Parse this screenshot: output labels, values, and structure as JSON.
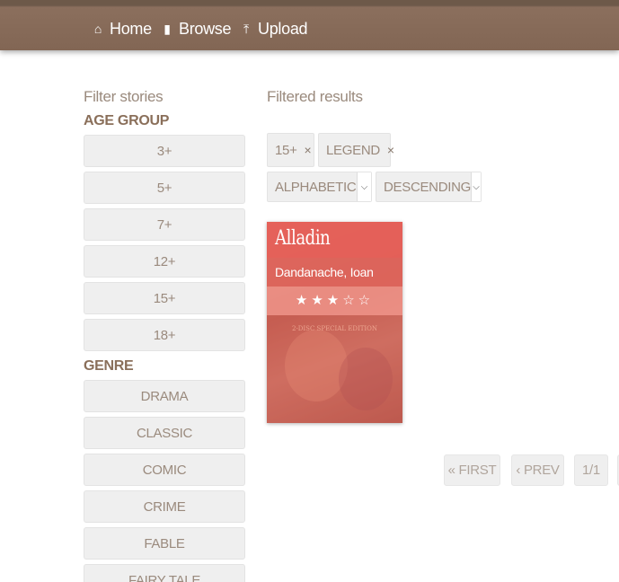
{
  "nav": {
    "items": [
      {
        "label": "Home",
        "icon": "home-icon",
        "glyph": "⌂"
      },
      {
        "label": "Browse",
        "icon": "book-icon",
        "glyph": "▮"
      },
      {
        "label": "Upload",
        "icon": "upload-icon",
        "glyph": "⤒"
      }
    ]
  },
  "sidebar": {
    "title": "Filter stories",
    "age_group": {
      "title": "AGE GROUP",
      "options": [
        "3+",
        "5+",
        "7+",
        "12+",
        "15+",
        "18+"
      ]
    },
    "genre": {
      "title": "GENRE",
      "options": [
        "DRAMA",
        "CLASSIC",
        "COMIC",
        "CRIME",
        "FABLE",
        "FAIRY TALE"
      ]
    }
  },
  "results": {
    "title": "Filtered results",
    "active_filters": [
      {
        "label": "15+",
        "remove": "×"
      },
      {
        "label": "LEGEND",
        "remove": "×"
      }
    ],
    "sort_field": "ALPHABETIC",
    "sort_order": "DESCENDING",
    "stories": [
      {
        "title": "Alladin",
        "author": "Dandanache, Ioan",
        "rating": 3,
        "max_rating": 5,
        "stars": "★★★☆☆",
        "cover_text": "2-DISC SPECIAL EDITION"
      }
    ],
    "pager": {
      "first": "« FIRST",
      "prev": "‹ PREV",
      "page": "1/1"
    }
  },
  "colors": {
    "nav_bg": "#826654",
    "card_title": "#e7615a",
    "card_author": "#e0665d",
    "card_rating": "#f2968c",
    "button_bg": "#efefef",
    "heading_brown": "#8a6f5a"
  }
}
